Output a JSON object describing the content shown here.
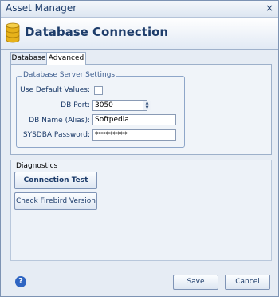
{
  "window": {
    "title": "Asset Manager",
    "close_glyph": "×",
    "close_icon": "close-icon"
  },
  "header": {
    "title": "Database Connection",
    "icon": "database-icon",
    "icon_color": "#e7b21a"
  },
  "tabs": [
    {
      "label": "Database",
      "active": false
    },
    {
      "label": "Advanced",
      "active": true
    }
  ],
  "server_settings": {
    "legend": "Database Server Settings",
    "use_default_label": "Use Default Values:",
    "use_default_checked": false,
    "port_label": "DB Port:",
    "port_value": "3050",
    "name_label": "DB Name (Alias):",
    "name_value": "Softpedia",
    "password_label": "SYSDBA Password:",
    "password_value": "*********"
  },
  "diagnostics": {
    "label": "Diagnostics",
    "connection_test": "Connection Test",
    "check_version": "Check Firebird Version"
  },
  "footer": {
    "help_glyph": "?",
    "save": "Save",
    "cancel": "Cancel"
  },
  "colors": {
    "accent": "#1e3d6b",
    "help": "#2f65c2"
  }
}
